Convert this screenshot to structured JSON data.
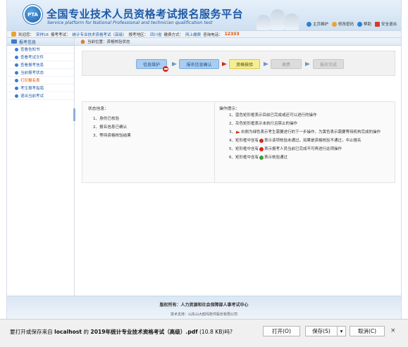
{
  "header": {
    "title_cn": "全国专业技术人员资格考试报名服务平台",
    "title_en": "Service platform for National Professional and technician qualification test",
    "logo_letters": "PTA",
    "links": [
      {
        "label": "主页维护",
        "icon": "home-icon",
        "color": "#2e7fd6"
      },
      {
        "label": "修改密码",
        "icon": "person-icon",
        "color": "#e7a33a"
      },
      {
        "label": "帮助",
        "icon": "help-icon",
        "color": "#2e7fd6"
      },
      {
        "label": "安全退出",
        "icon": "exit-icon",
        "color": "#d43b2b"
      }
    ]
  },
  "infobar": {
    "welcome": "欢迎您：",
    "user": "宋祥16",
    "exam_label": "报考考试：",
    "exam": "统计专业技术资格考试（高级）",
    "area_label": "报考地区：",
    "area": "四川省",
    "mode_label": "缴费方式：",
    "mode": "网上缴费",
    "phone_label": "咨询电话：",
    "phone": "12333"
  },
  "sidebar": {
    "title": "报考信息",
    "items": [
      {
        "label": "查看告知书",
        "active": false
      },
      {
        "label": "查看考试文件",
        "active": false
      },
      {
        "label": "查看报考信息",
        "active": false
      },
      {
        "label": "当前报考状态",
        "active": false
      },
      {
        "label": "打印报名表",
        "active": true
      },
      {
        "label": "考生报考指南",
        "active": false
      },
      {
        "label": "退出当前考试",
        "active": false
      }
    ]
  },
  "breadcrumb": {
    "text": "当前位置：资格核验状态"
  },
  "steps": [
    "信息维护",
    "报名信息确认",
    "资格核验",
    "缴费",
    "报名完成"
  ],
  "status_panel": {
    "title": "状态信息：",
    "items": [
      "1、身份已核验",
      "2、报名信息已确认",
      "3、等待资格核验结果"
    ]
  },
  "hint_panel": {
    "title": "操作提示：",
    "items": [
      {
        "num": "1、",
        "pre": "",
        "icon": "",
        "post": "蓝色矩形框表示目前已完成或还可以进行的操作"
      },
      {
        "num": "2、",
        "pre": "",
        "icon": "",
        "post": "灰色矩形框表示未执行且禁止的操作"
      },
      {
        "num": "3、",
        "pre": "",
        "icon": "arrow",
        "post": "右侧为绿色表示考生需要进行的下一步操作，为黄色表示需要等待机构完成的操作"
      },
      {
        "num": "4、",
        "pre": "矩形框中含有",
        "icon": "red",
        "post": "表示该项核验未通过，如果是资格核验不通过，中止报名"
      },
      {
        "num": "5、",
        "pre": "矩形框中含有",
        "icon": "red",
        "post": "表示报考人员当前已完成不可再进行此项操作"
      },
      {
        "num": "6、",
        "pre": "矩形框中含有",
        "icon": "green",
        "post": "表示核验通过"
      }
    ]
  },
  "footer": {
    "copyright": "版权所有：人力资源和社会保障部人事考试中心",
    "support": "技术支持：山东山大鸥玛软件股份有限公司"
  },
  "download_bar": {
    "prefix": "要打开或保存来自 ",
    "host": "localhost",
    "middle": " 的 ",
    "filename": "2019年统计专业技术资格考试（高级）.pdf",
    "size": " (10.8 KB)吗?",
    "open": "打开(O)",
    "save": "保存(S)",
    "dropdown": "▾",
    "cancel": "取消(C)",
    "close": "×"
  }
}
